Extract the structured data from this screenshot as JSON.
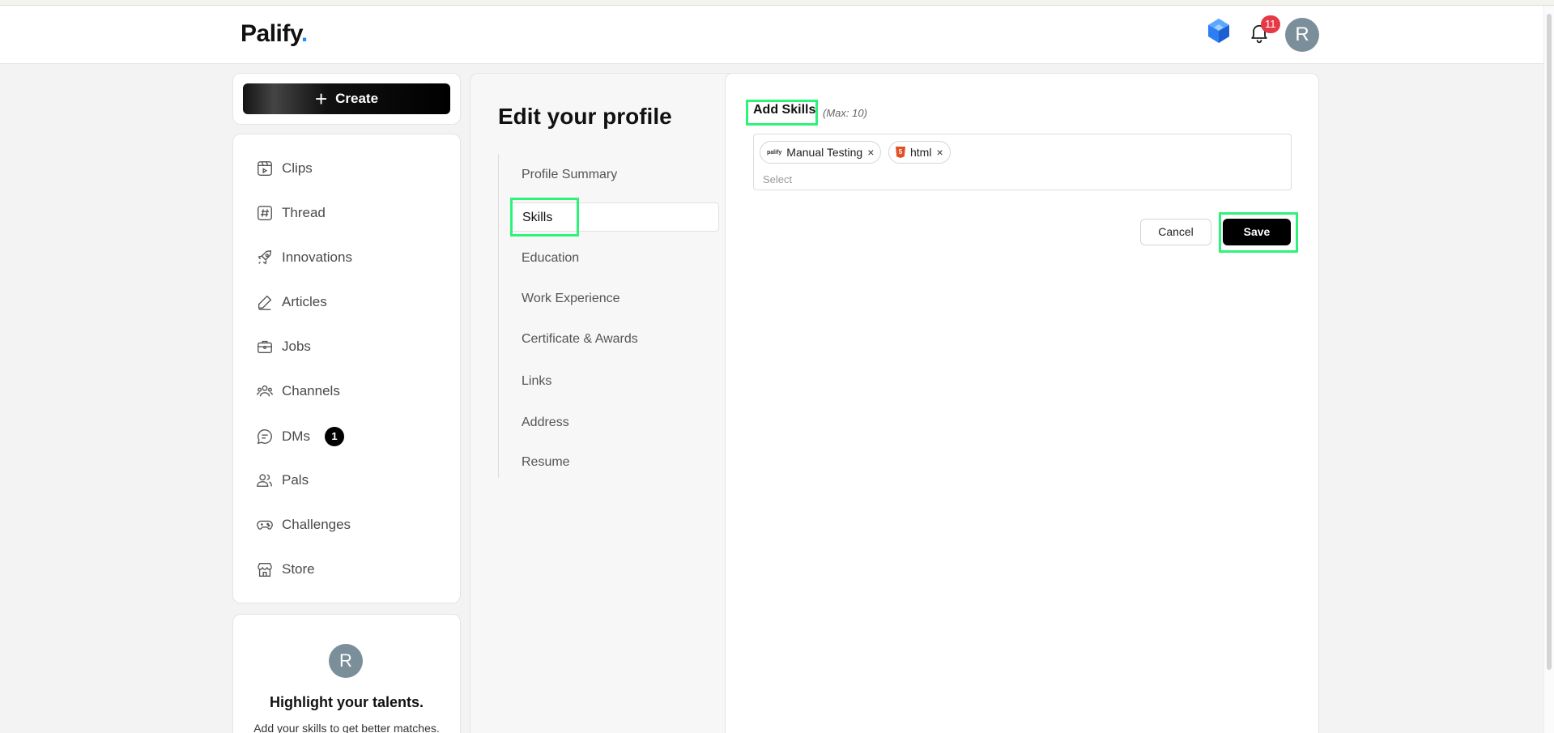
{
  "header": {
    "logo_text": "Palify",
    "logo_dot": ".",
    "notification_count": "11",
    "avatar_initial": "R"
  },
  "sidebar": {
    "create_label": "Create",
    "items": [
      {
        "label": "Clips",
        "icon": "clips-icon"
      },
      {
        "label": "Thread",
        "icon": "hash-icon"
      },
      {
        "label": "Innovations",
        "icon": "rocket-icon"
      },
      {
        "label": "Articles",
        "icon": "pen-icon"
      },
      {
        "label": "Jobs",
        "icon": "briefcase-icon"
      },
      {
        "label": "Channels",
        "icon": "people-icon"
      },
      {
        "label": "DMs",
        "icon": "chat-icon",
        "badge": "1"
      },
      {
        "label": "Pals",
        "icon": "pals-icon"
      },
      {
        "label": "Challenges",
        "icon": "gamepad-icon"
      },
      {
        "label": "Store",
        "icon": "store-icon"
      }
    ]
  },
  "talent": {
    "avatar_initial": "R",
    "title": "Highlight your talents.",
    "subtitle": "Add your skills to get better matches."
  },
  "profile": {
    "title": "Edit your profile",
    "sections": [
      "Profile Summary",
      "Skills",
      "Education",
      "Work Experience",
      "Certificate & Awards",
      "Links",
      "Address",
      "Resume"
    ],
    "active_section": "Skills"
  },
  "skills": {
    "label": "Add Skills",
    "max_text": "(Max: 10)",
    "chips": [
      {
        "label": "Manual Testing",
        "logo": "palify",
        "remove": "×"
      },
      {
        "label": "html",
        "logo": "5",
        "remove": "×"
      }
    ],
    "select_placeholder": "Select",
    "cancel_label": "Cancel",
    "save_label": "Save"
  },
  "colors": {
    "highlight": "#2ef27a",
    "badge_red": "#e63946",
    "avatar": "#7b8f9a",
    "gem_blue": "#1f8cff"
  }
}
